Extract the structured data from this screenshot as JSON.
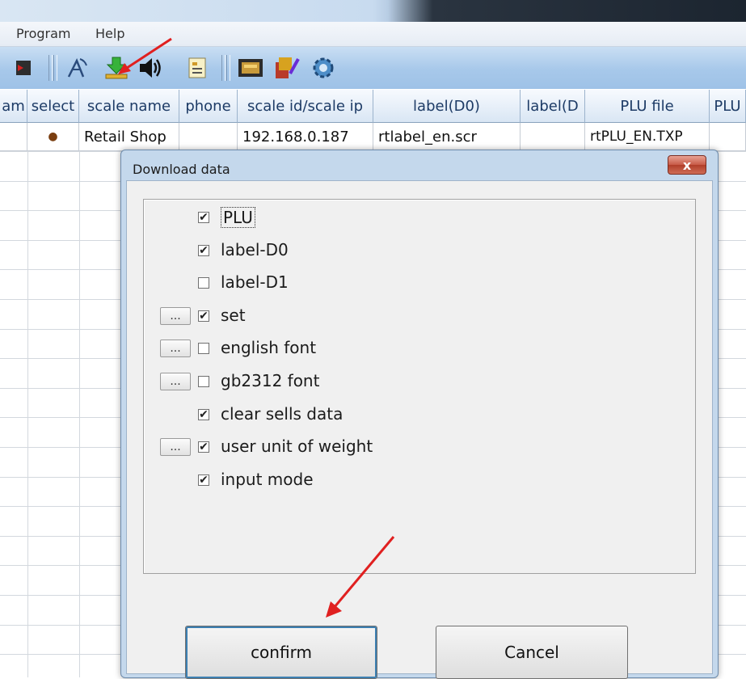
{
  "window": {
    "title": ""
  },
  "menu": {
    "items": [
      "Program",
      "Help"
    ]
  },
  "toolbar": {
    "buttons": [
      "exit-icon",
      "connect-icon",
      "download-icon",
      "speaker-icon",
      "document-icon",
      "register-icon",
      "tools-icon",
      "settings-icon"
    ]
  },
  "grid": {
    "columns": [
      "am",
      "select",
      "scale name",
      "phone",
      "scale id/scale ip",
      "label(D0)",
      "label(D",
      "PLU file",
      "PLU"
    ],
    "rows": [
      {
        "select": "●",
        "scale_name": "Retail Shop",
        "phone": "",
        "scale_ip": "192.168.0.187",
        "label_d0": "rtlabel_en.scr",
        "label_d1": "",
        "plu_file": "rtPLU_EN.TXP",
        "plu": ""
      }
    ]
  },
  "dialog": {
    "title": "Download data",
    "close_label": "x",
    "options": [
      {
        "label": "PLU",
        "checked": true,
        "has_more": false
      },
      {
        "label": "label-D0",
        "checked": true,
        "has_more": false
      },
      {
        "label": "label-D1",
        "checked": false,
        "has_more": false
      },
      {
        "label": "set",
        "checked": true,
        "has_more": true
      },
      {
        "label": "english font",
        "checked": false,
        "has_more": true
      },
      {
        "label": "gb2312 font",
        "checked": false,
        "has_more": true
      },
      {
        "label": "clear sells data",
        "checked": true,
        "has_more": false
      },
      {
        "label": "user unit of weight",
        "checked": true,
        "has_more": true
      },
      {
        "label": "input mode",
        "checked": true,
        "has_more": false
      }
    ],
    "more_label": "...",
    "confirm_label": "confirm",
    "cancel_label": "Cancel"
  },
  "colors": {
    "accent_arrow": "#e02020",
    "toolbar": "#a7c8ea",
    "header_text": "#1d3b66"
  }
}
